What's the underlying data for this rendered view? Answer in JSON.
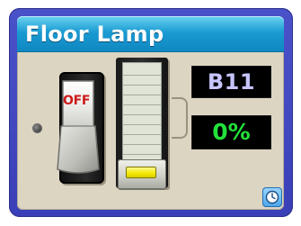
{
  "device": {
    "title": "Floor Lamp",
    "switch_state": "OFF",
    "address": "B11",
    "level": "0%",
    "level_fraction": 0
  },
  "icons": {
    "schedule": "clock-icon",
    "screw": "screw-icon"
  },
  "colors": {
    "title_bar": "#1a9ad2",
    "frame": "#3a3fb8",
    "panel": "#dcd5c2",
    "address_text": "#c7c4ff",
    "level_text": "#22e23a",
    "switch_off_text": "#cc1b1b",
    "knob_indicator": "#f3e800"
  }
}
